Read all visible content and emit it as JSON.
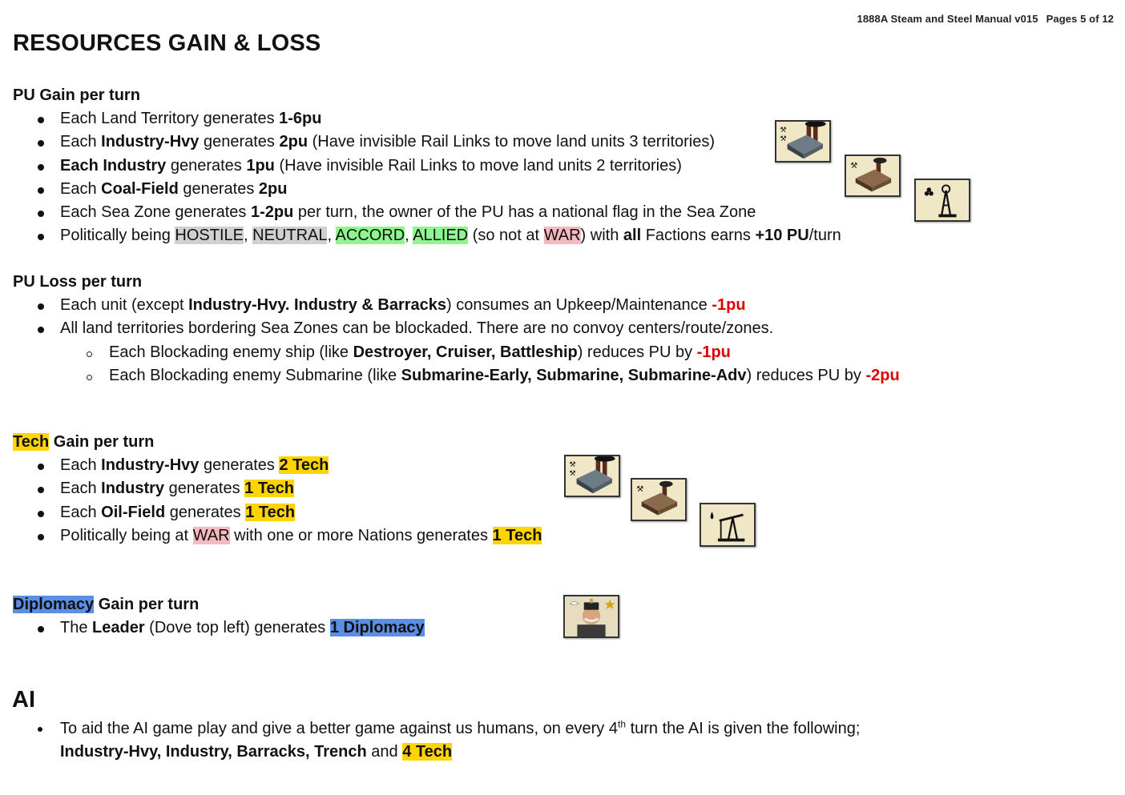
{
  "header": {
    "doc": "1888A Steam and Steel Manual v015",
    "pages": "Pages 5 of 12"
  },
  "title": "RESOURCES GAIN & LOSS",
  "pu_gain": {
    "heading": "PU Gain per turn",
    "l1": {
      "a": "Each Land Territory generates ",
      "b": "1-6pu"
    },
    "l2": {
      "a": "Each ",
      "b": "Industry-Hvy",
      "c": " generates ",
      "d": "2pu",
      "e": " (Have invisible Rail Links to move land units 3 territories)"
    },
    "l3": {
      "a": "Each Industry",
      "b": " generates ",
      "c": "1pu",
      "d": " (Have invisible Rail Links to move land units 2 territories)"
    },
    "l4": {
      "a": "Each ",
      "b": "Coal-Field",
      "c": " generates ",
      "d": "2pu"
    },
    "l5": {
      "a": "Each Sea Zone generates ",
      "b": "1-2pu",
      "c": " per turn, the owner of the PU has a national flag in the Sea Zone"
    },
    "l6": {
      "a": "Politically being ",
      "hostile": "HOSTILE",
      "s1": ", ",
      "neutral": "NEUTRAL",
      "s2": ", ",
      "accord": "ACCORD",
      "s3": ", ",
      "allied": "ALLIED",
      "s4": " (so not at ",
      "war": "WAR",
      "s5": ") with ",
      "all": "all",
      "s6": " Factions earns ",
      "pu": "+10 PU",
      "s7": "/turn"
    }
  },
  "pu_loss": {
    "heading": "PU Loss per turn",
    "l1": {
      "a": "Each unit (except ",
      "b": "Industry-Hvy. Industry & Barracks",
      "c": ") consumes an Upkeep/Maintenance ",
      "d": "-1pu"
    },
    "l2": {
      "a": "All land territories bordering Sea Zones can be blockaded.  There are no convoy centers/route/zones."
    },
    "s1": {
      "a": "Each Blockading enemy ship (like ",
      "b": "Destroyer, Cruiser, Battleship",
      "c": ") reduces PU by ",
      "d": "-1pu"
    },
    "s2": {
      "a": "Each Blockading enemy Submarine (like ",
      "b": "Submarine-Early, Submarine, Submarine-Adv",
      "c": ") reduces PU by ",
      "d": "-2pu"
    }
  },
  "tech_gain": {
    "heading_hl": "Tech",
    "heading_rest": " Gain per turn",
    "l1": {
      "a": "Each ",
      "b": "Industry-Hvy",
      "c": " generates ",
      "d": "2 Tech"
    },
    "l2": {
      "a": "Each ",
      "b": "Industry",
      "c": " generates ",
      "d": "1 Tech"
    },
    "l3": {
      "a": "Each ",
      "b": "Oil-Field",
      "c": " generates ",
      "d": "1 Tech"
    },
    "l4": {
      "a": "Politically being at ",
      "war": "WAR",
      "b": " with one or more Nations generates ",
      "c": "1 Tech"
    }
  },
  "diplomacy_gain": {
    "heading_hl": "Diplomacy",
    "heading_rest": " Gain per turn",
    "l1": {
      "a": "The ",
      "b": "Leader",
      "c": " (Dove top left) generates ",
      "d": "1 Diplomacy"
    }
  },
  "ai": {
    "heading": "AI",
    "a": "To aid the AI game play and give a better game against us humans, on every 4",
    "sup": "th",
    "b": " turn the AI is given the following;",
    "c": "Industry-Hvy, Industry, Barracks, Trench",
    "d": " and ",
    "e": "4 Tech"
  },
  "icons": {
    "industry_hvy": "industry-hvy-icon",
    "industry": "industry-icon",
    "coal_field": "coal-field-icon",
    "oil_field": "oil-field-icon",
    "leader": "leader-icon"
  },
  "colors": {
    "red": "#e00000",
    "yellow": "#ffd400",
    "blue": "#5b8fe6",
    "green": "#8ff58f",
    "pink": "#f7b9c0",
    "gray": "#d0d0d0"
  }
}
